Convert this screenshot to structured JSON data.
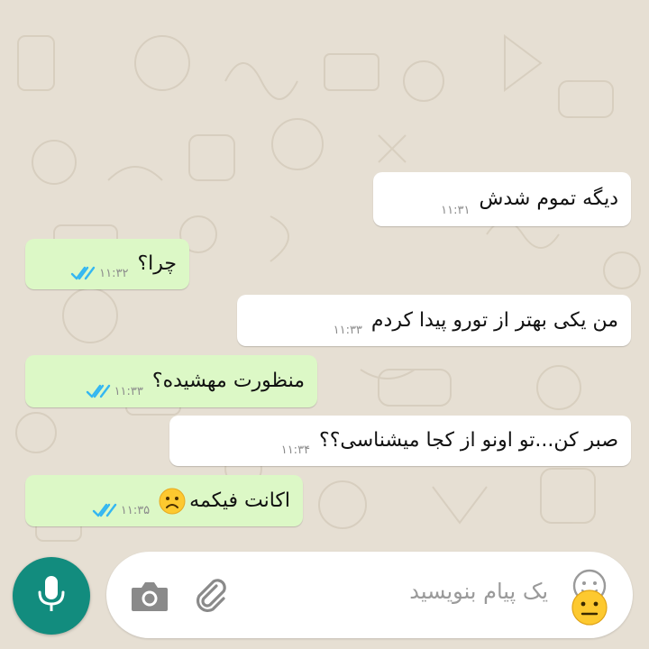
{
  "chat": {
    "messages": [
      {
        "direction": "incoming",
        "text": "دیگه تموم شدش",
        "time": "۱۱:۳۱"
      },
      {
        "direction": "outgoing",
        "text": "چرا؟",
        "time": "۱۱:۳۲",
        "status": "read"
      },
      {
        "direction": "incoming",
        "text": "من یکی بهتر از تورو پیدا کردم",
        "time": "۱۱:۳۳"
      },
      {
        "direction": "outgoing",
        "text": "منظورت مهشیده؟",
        "time": "۱۱:۳۳",
        "status": "read"
      },
      {
        "direction": "incoming",
        "text": "صبر کن...تو اونو از کجا میشناسی؟؟",
        "time": "۱۱:۳۴"
      },
      {
        "direction": "outgoing",
        "text": "اکانت فیکمه",
        "time": "۱۱:۳۵",
        "status": "read",
        "emoji": "sad-face"
      }
    ]
  },
  "composer": {
    "placeholder": "یک پیام بنویسید",
    "icons": {
      "emoji": "emoji-face-icon",
      "attach": "paperclip-icon",
      "camera": "camera-icon",
      "mic": "microphone-icon"
    }
  },
  "colors": {
    "wallpaper": "#e6dfd3",
    "incoming_bubble": "#ffffff",
    "outgoing_bubble": "#dcf8c6",
    "read_ticks": "#34b7f1",
    "mic_button": "#128c7e"
  }
}
